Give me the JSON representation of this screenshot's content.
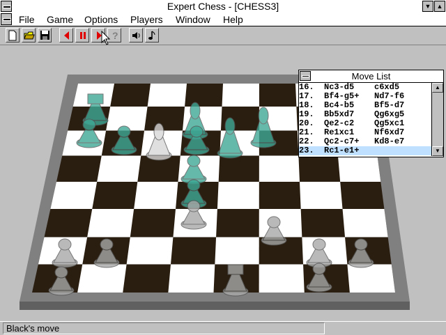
{
  "window": {
    "title": "Expert Chess - [CHESS3]"
  },
  "menu": [
    {
      "label": "File"
    },
    {
      "label": "Game"
    },
    {
      "label": "Options"
    },
    {
      "label": "Players"
    },
    {
      "label": "Window"
    },
    {
      "label": "Help"
    }
  ],
  "toolbar": {
    "buttons": [
      "new-file",
      "open-folder",
      "save-disk",
      "back-arrow",
      "pause",
      "forward-arrow",
      "hint-question",
      "sound-speaker",
      "music-note"
    ]
  },
  "move_list": {
    "title": "Move List",
    "rows": [
      "16.  Nc3-d5    c6xd5",
      "17.  Bf4-g5+   Nd7-f6",
      "18.  Bc4-b5    Bf5-d7",
      "19.  Bb5xd7    Qg6xg5",
      "20.  Qe2-c2    Qg5xc1",
      "21.  Re1xc1    Nf6xd7",
      "22.  Qc2-c7+   Kd8-e7",
      "23.  Rc1-e1+"
    ],
    "selected_index": 7
  },
  "status": {
    "text": "Black's move"
  },
  "colors": {
    "board_dark": "#2a1e10",
    "board_light": "#ffffff",
    "board_frame": "#808080",
    "background": "#c0c0c0",
    "black_pieces": "#3fa896",
    "white_pieces": "#a8a8a8"
  }
}
